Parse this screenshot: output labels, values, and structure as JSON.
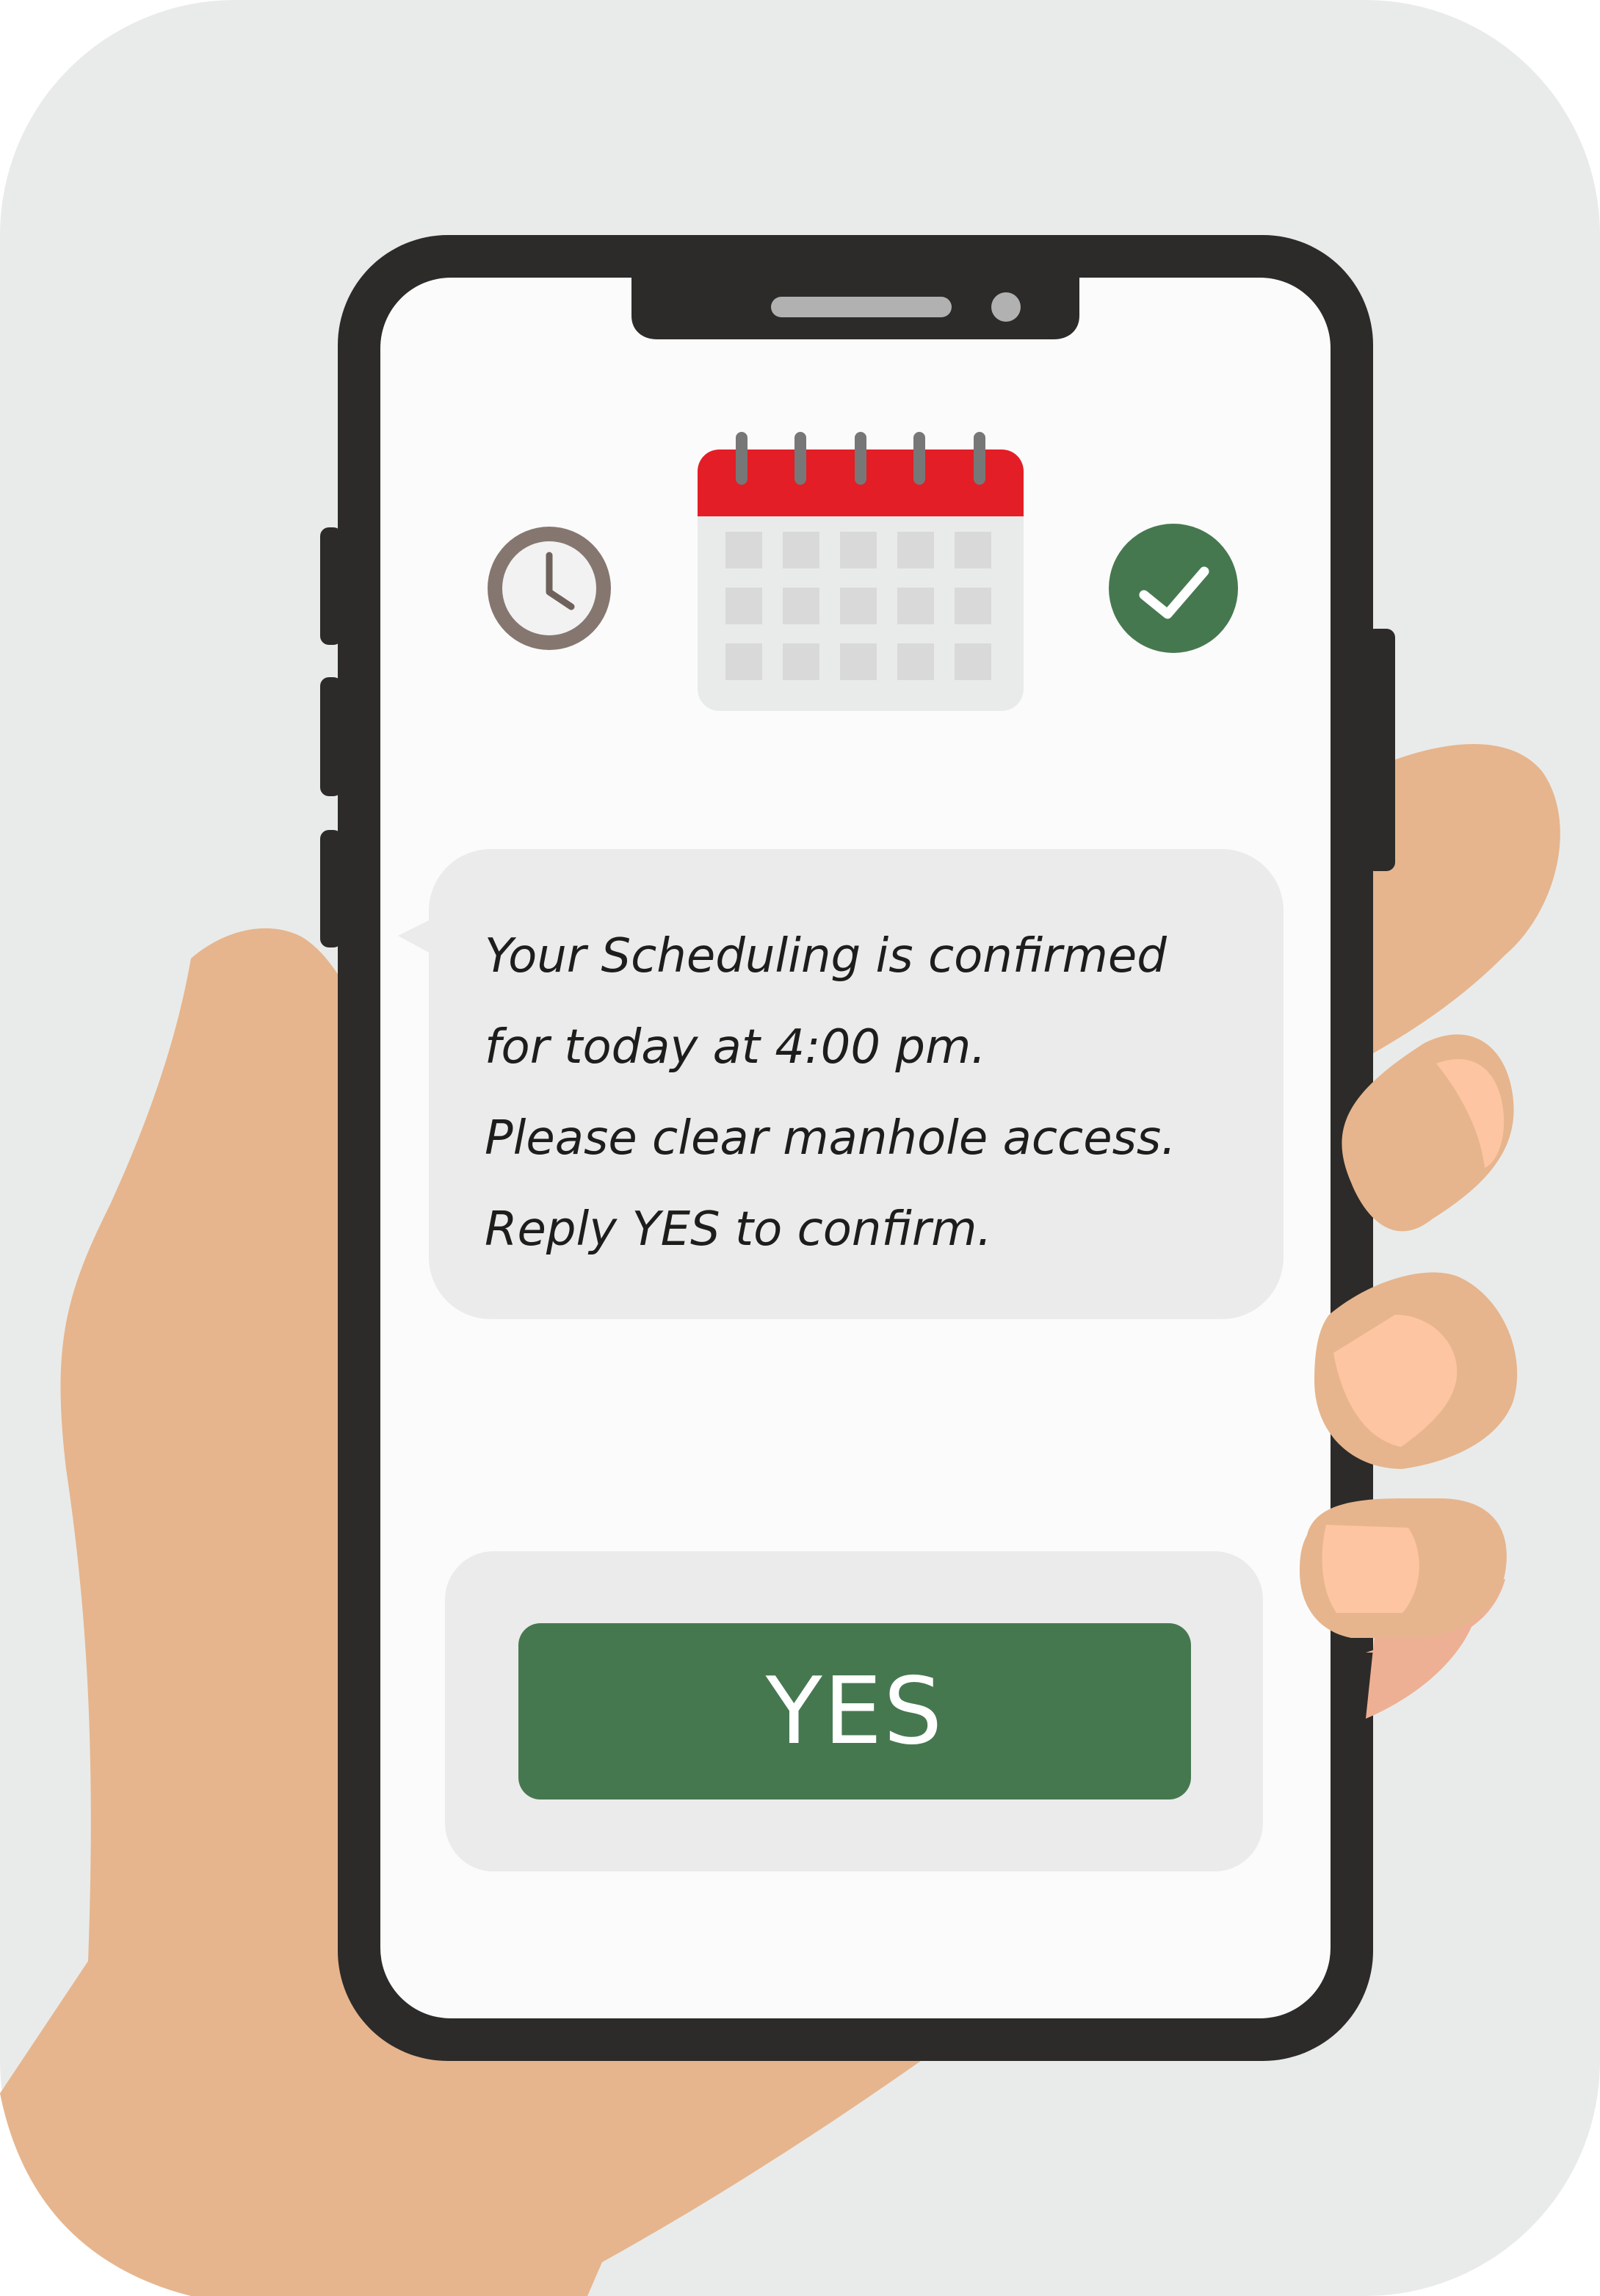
{
  "message": {
    "lines": [
      "Your Scheduling is confirmed",
      "for today at 4:00 pm.",
      "Please clear manhole access.",
      "Reply YES to confirm."
    ]
  },
  "reply_button": {
    "label": "YES"
  },
  "icons": {
    "left": "clock-icon",
    "center": "calendar-icon",
    "right": "check-circle-icon"
  },
  "colors": {
    "background": "#e9ebea",
    "phone_body": "#2c2b29",
    "screen": "#fbfbfb",
    "bubble": "#eaebea",
    "skin": "#e6b58d",
    "fingernail": "#fdc5a2",
    "calendar_header": "#e31e26",
    "accent_green": "#467850",
    "clock_ring": "#857770"
  }
}
